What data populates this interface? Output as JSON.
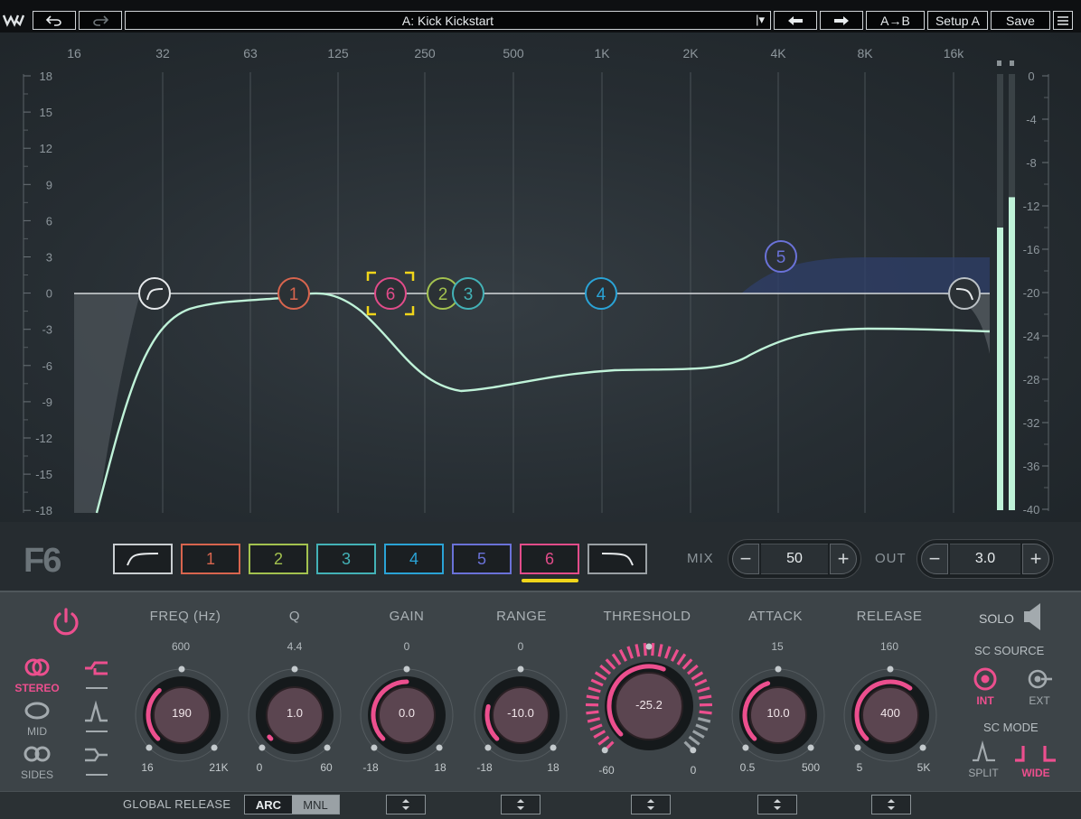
{
  "topbar": {
    "preset_name": "A: Kick Kickstart",
    "preset_dropdown_marker": "|▾",
    "ab_label": "A→B",
    "setup_label": "Setup A",
    "save_label": "Save"
  },
  "graph": {
    "freq_labels": [
      "16",
      "32",
      "63",
      "125",
      "250",
      "500",
      "1K",
      "2K",
      "4K",
      "8K",
      "16k"
    ],
    "gain_labels": [
      "18",
      "15",
      "12",
      "9",
      "6",
      "3",
      "0",
      "-3",
      "-6",
      "-9",
      "-12",
      "-15",
      "-18"
    ],
    "meter_labels": [
      "0",
      "-4",
      "-8",
      "-12",
      "-16",
      "-20",
      "-24",
      "-28",
      "-32",
      "-36",
      "-40"
    ],
    "node_labels": [
      "1",
      "6",
      "2",
      "3",
      "4",
      "5"
    ],
    "meter_left_level_db": -14.0,
    "meter_right_level_db": -11.2
  },
  "bands": {
    "labels": [
      "1",
      "2",
      "3",
      "4",
      "5",
      "6"
    ],
    "colors": [
      "#d8654e",
      "#a3c24f",
      "#43b2b7",
      "#2aa3d6",
      "#6a72d8",
      "#e24c8a"
    ],
    "selected": "6"
  },
  "mix": {
    "label": "MIX",
    "value": "50",
    "minus": "−",
    "plus": "+"
  },
  "out": {
    "label": "OUT",
    "value": "3.0",
    "minus": "−",
    "plus": "+"
  },
  "params": [
    {
      "title": "FREQ (Hz)",
      "top": "600",
      "min": "16",
      "max": "21K",
      "value": "190"
    },
    {
      "title": "Q",
      "top": "4.4",
      "min": "0",
      "max": "60",
      "value": "1.0"
    },
    {
      "title": "GAIN",
      "top": "0",
      "min": "-18",
      "max": "18",
      "value": "0.0"
    },
    {
      "title": "RANGE",
      "top": "0",
      "min": "-18",
      "max": "18",
      "value": "-10.0"
    },
    {
      "title": "THRESHOLD",
      "top": "",
      "min": "-60",
      "max": "0",
      "value": "-25.2"
    },
    {
      "title": "ATTACK",
      "top": "15",
      "min": "0.5",
      "max": "500",
      "value": "10.0"
    },
    {
      "title": "RELEASE",
      "top": "160",
      "min": "5",
      "max": "5K",
      "value": "400"
    }
  ],
  "modes": {
    "stereo": "STEREO",
    "mid": "MID",
    "sides": "SIDES"
  },
  "solo": {
    "label": "SOLO"
  },
  "sc_source": {
    "label": "SC SOURCE",
    "int": "INT",
    "ext": "EXT"
  },
  "sc_mode": {
    "label": "SC MODE",
    "split": "SPLIT",
    "wide": "WIDE"
  },
  "footer": {
    "global_release": "GLOBAL RELEASE",
    "arc": "ARC",
    "mnl": "MNL"
  },
  "accent": "#ec4f8e"
}
